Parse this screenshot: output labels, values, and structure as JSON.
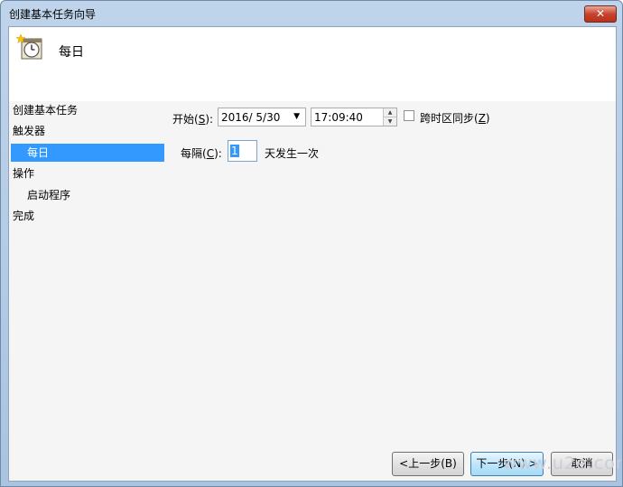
{
  "window": {
    "title": "创建基本任务向导",
    "close_label": "✕"
  },
  "header": {
    "title": "每日",
    "icon": "clock-calendar-icon"
  },
  "nav": {
    "items": [
      {
        "label": "创建基本任务"
      },
      {
        "label": "触发器"
      },
      {
        "label": "每日"
      },
      {
        "label": "操作"
      },
      {
        "label": "启动程序"
      },
      {
        "label": "完成"
      }
    ]
  },
  "form": {
    "start_label": "开始(",
    "start_key": "S",
    "start_suffix": "):",
    "date_value": "2016/  5/30",
    "time_value": "17:09:40",
    "sync_label": "跨时区同步(",
    "sync_key": "Z",
    "sync_suffix": ")",
    "interval_label": "每隔(",
    "interval_key": "C",
    "interval_suffix": "):",
    "interval_value": "1",
    "interval_unit": "天发生一次"
  },
  "buttons": {
    "back": "<上一步(B)",
    "next": "下一步(N) >",
    "cancel": "取消"
  },
  "watermark": "www.u2e.com"
}
